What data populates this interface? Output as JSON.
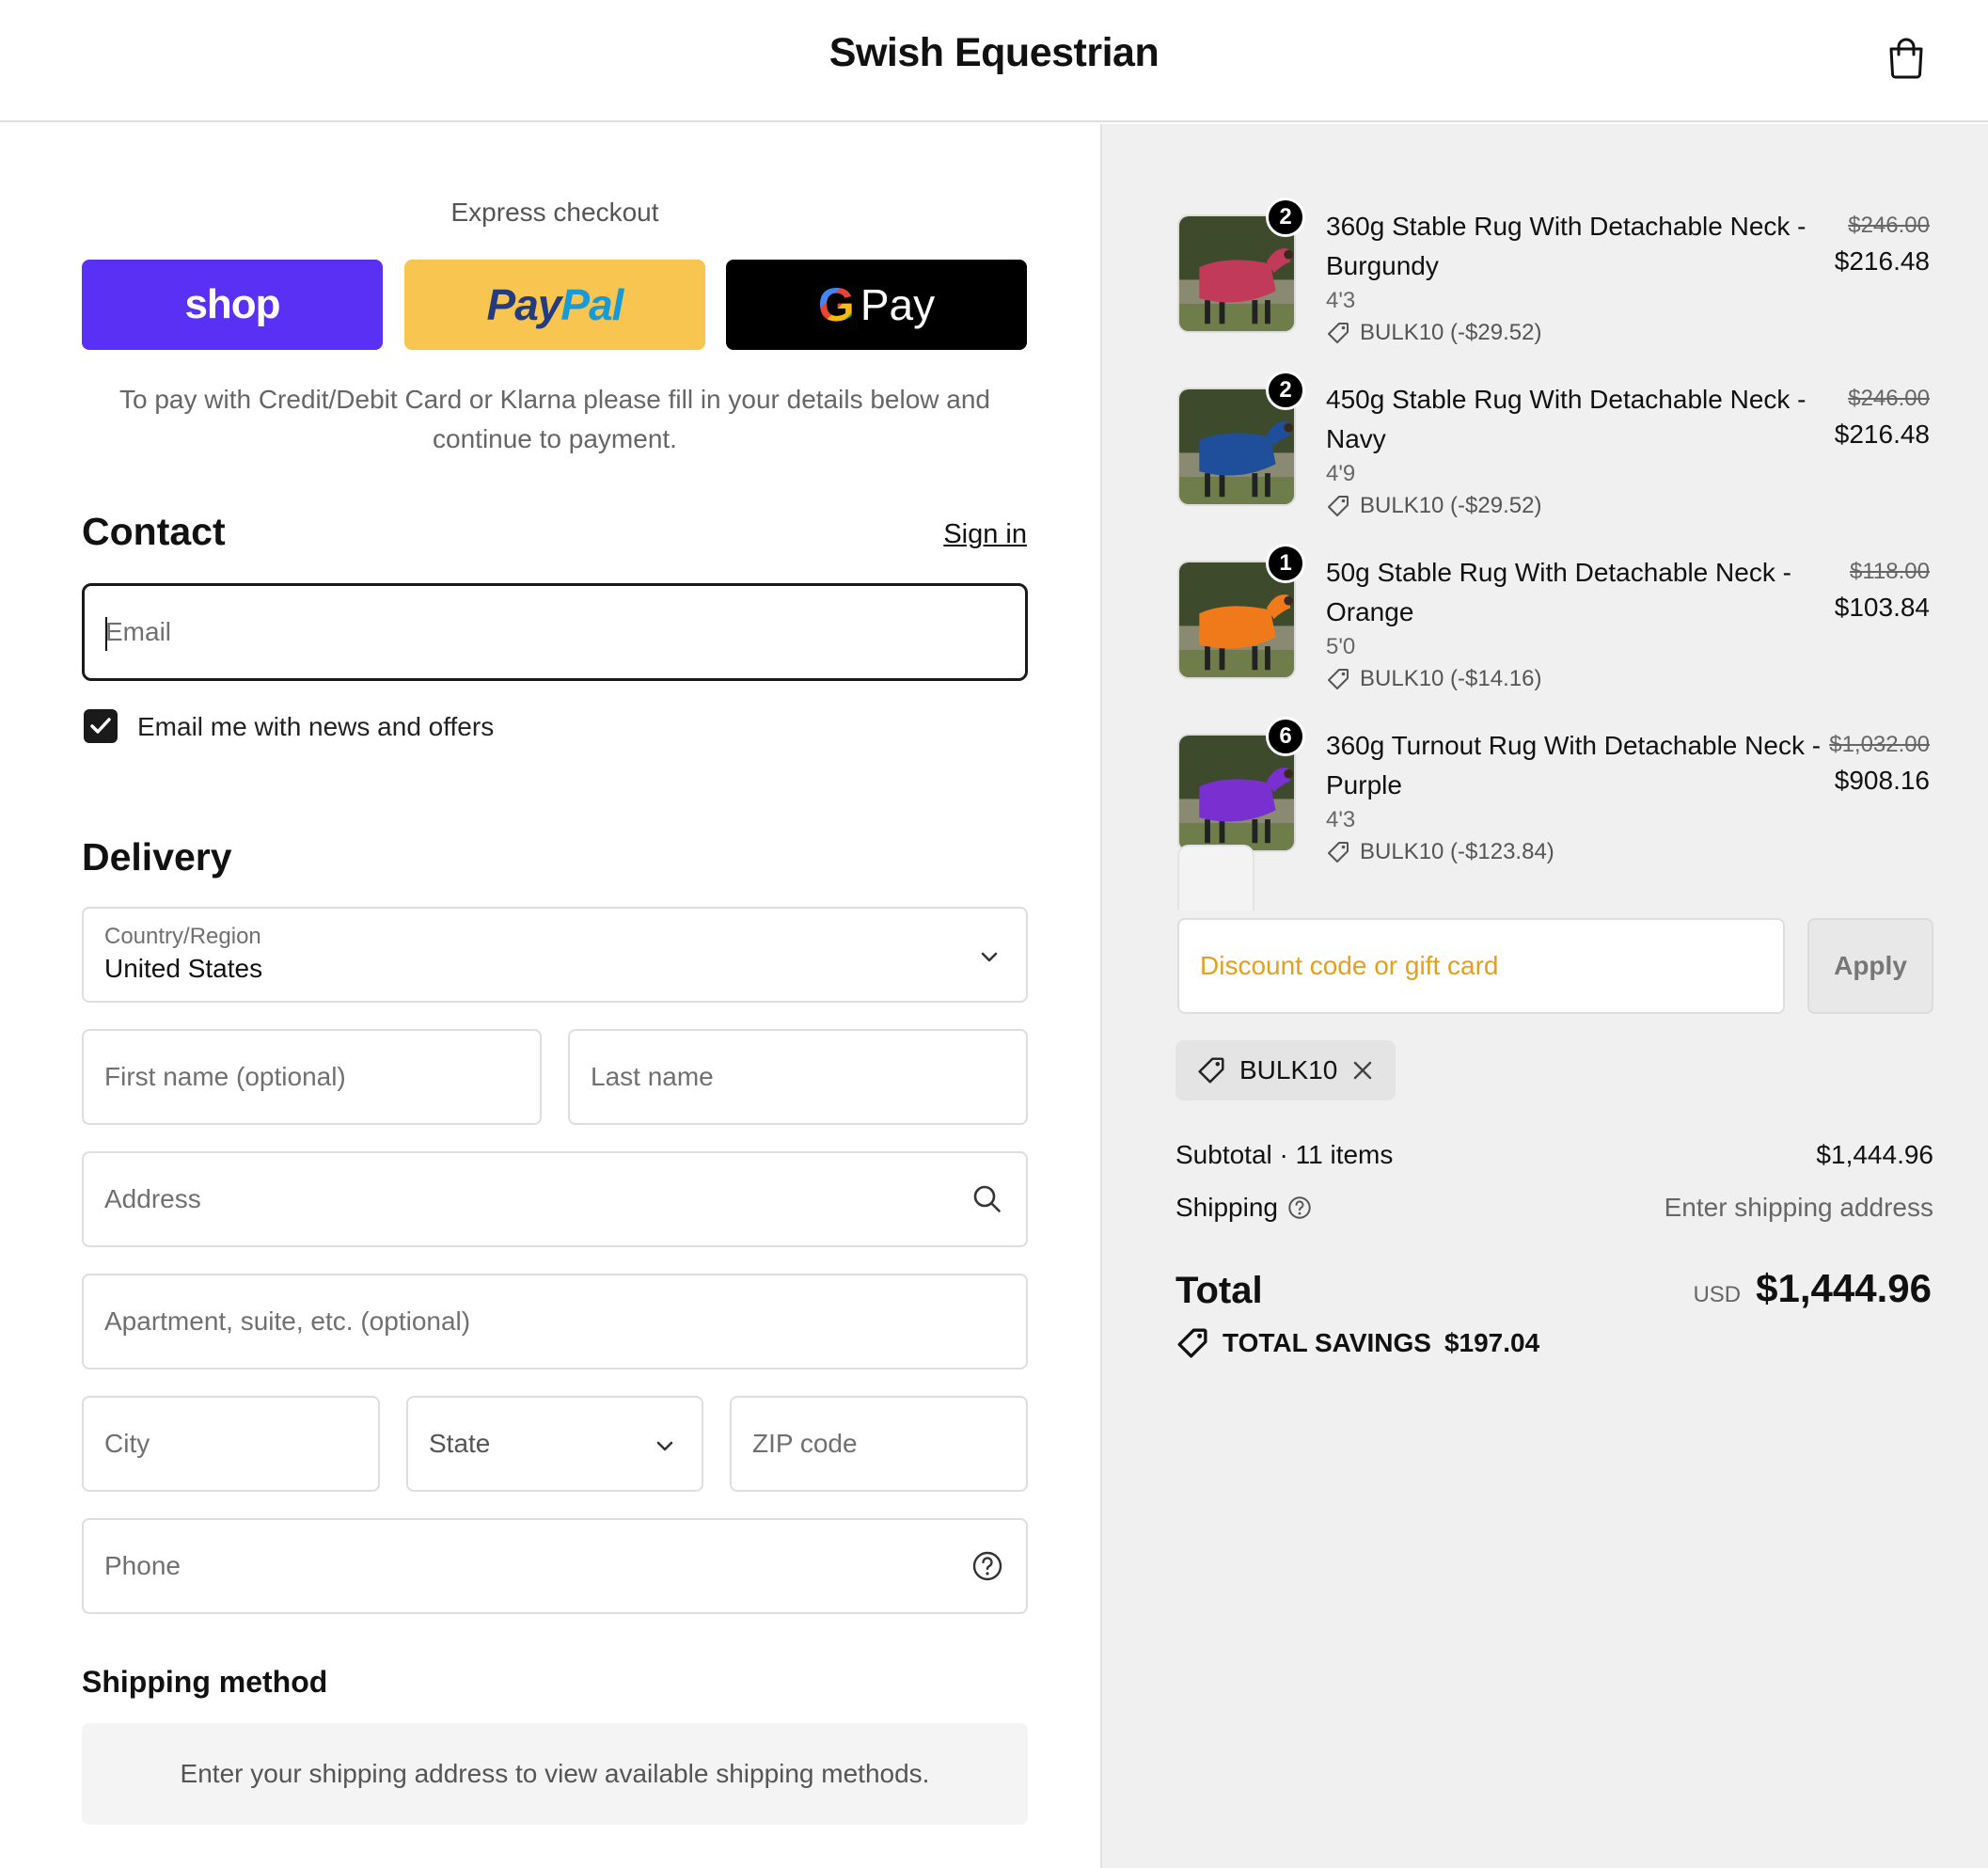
{
  "header": {
    "brand": "Swish Equestrian",
    "cart_icon": "shopping-bag-icon"
  },
  "express": {
    "title": "Express checkout",
    "buttons": {
      "shop": "shop",
      "paypal_a": "Pay",
      "paypal_b": "Pal",
      "gpay_g": "G",
      "gpay_text": "Pay"
    },
    "note": "To pay with Credit/Debit Card or Klarna please fill in your details below and continue to payment."
  },
  "contact": {
    "heading": "Contact",
    "signin": "Sign in",
    "email_placeholder": "Email",
    "newsletter_label": "Email me with news and offers",
    "newsletter_checked": true
  },
  "delivery": {
    "heading": "Delivery",
    "country_label": "Country/Region",
    "country_value": "United States",
    "first_name": "First name (optional)",
    "last_name": "Last name",
    "address": "Address",
    "apartment": "Apartment, suite, etc. (optional)",
    "city": "City",
    "state": "State",
    "zip": "ZIP code",
    "phone": "Phone"
  },
  "shipping_method": {
    "heading": "Shipping method",
    "note": "Enter your shipping address to view available shipping methods."
  },
  "order": {
    "items": [
      {
        "qty": "2",
        "name": "360g Stable Rug With Detachable Neck - Burgundy",
        "variant": "4'3",
        "discount": "BULK10 (-$29.52)",
        "price_old": "$246.00",
        "price_new": "$216.48",
        "color": "#c23a5a"
      },
      {
        "qty": "2",
        "name": "450g Stable Rug With Detachable Neck - Navy",
        "variant": "4'9",
        "discount": "BULK10 (-$29.52)",
        "price_old": "$246.00",
        "price_new": "$216.48",
        "color": "#1f4f9a"
      },
      {
        "qty": "1",
        "name": "50g Stable Rug With Detachable Neck - Orange",
        "variant": "5'0",
        "discount": "BULK10 (-$14.16)",
        "price_old": "$118.00",
        "price_new": "$103.84",
        "color": "#f07a1a"
      },
      {
        "qty": "6",
        "name": "360g Turnout Rug With Detachable Neck - Purple",
        "variant": "4'3",
        "discount": "BULK10 (-$123.84)",
        "price_old": "$1,032.00",
        "price_new": "$908.16",
        "color": "#7a2fd0"
      }
    ],
    "discount_placeholder": "Discount code or gift card",
    "apply_label": "Apply",
    "applied_code": "BULK10",
    "subtotal_label": "Subtotal · 11 items",
    "subtotal_value": "$1,444.96",
    "shipping_label": "Shipping",
    "shipping_value": "Enter shipping address",
    "total_label": "Total",
    "currency": "USD",
    "total_value": "$1,444.96",
    "savings_label": "TOTAL SAVINGS",
    "savings_value": "$197.04"
  }
}
